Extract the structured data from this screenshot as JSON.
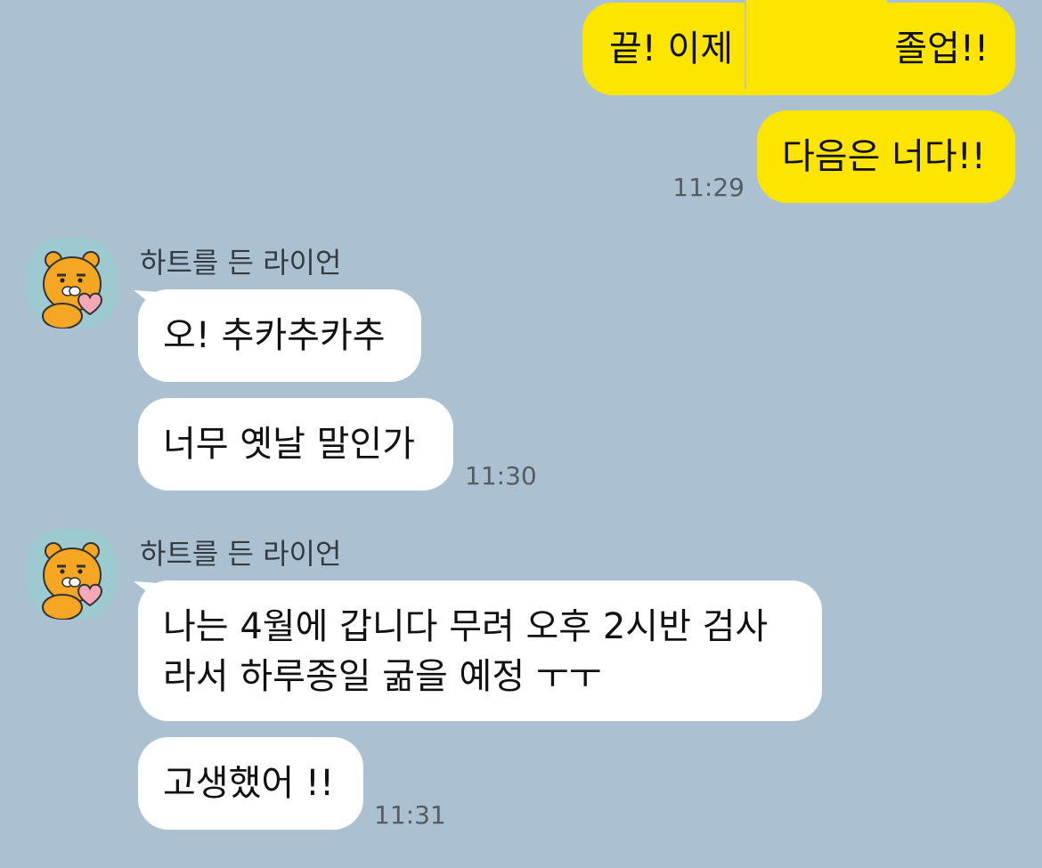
{
  "conversation": {
    "sent": {
      "message_1_before": "끝! 이제",
      "message_1_after": "졸업!!",
      "message_2": "다음은 너다!!",
      "time": "11:29"
    },
    "group_1": {
      "sender": "하트를 든 라이언",
      "message_1": "오! 추카추카추",
      "message_2": "너무 옛날 말인가",
      "time": "11:30"
    },
    "group_2": {
      "sender": "하트를 든 라이언",
      "message_1_line_1": "나는 4월에 갑니다 무려 오후 2시반 검사",
      "message_1_line_2": "라서 하루종일 굶을 예정 ㅜㅜ",
      "message_2": "고생했어 !!",
      "time": "11:31"
    }
  },
  "avatar": {
    "icon": "ryan-holding-heart-icon",
    "background": "#9ccad0",
    "face_color": "#f5a623",
    "heart_color": "#f7a8b8"
  },
  "colors": {
    "chat_background": "#abc1d1",
    "sent_bubble": "#fee500",
    "received_bubble": "#ffffff",
    "timestamp": "#555c62"
  }
}
